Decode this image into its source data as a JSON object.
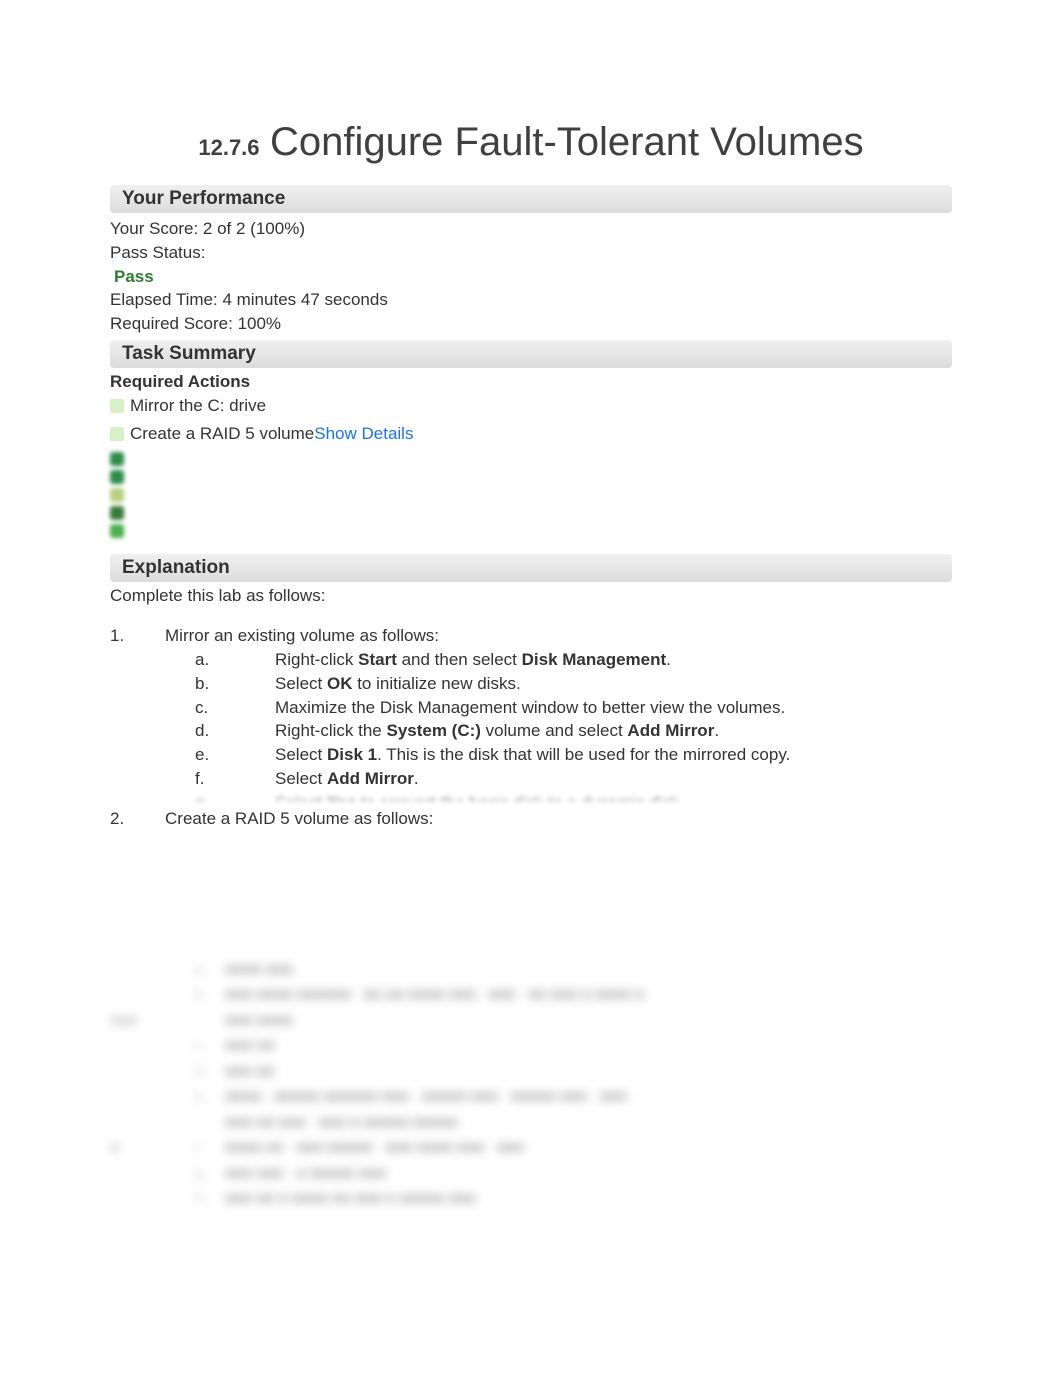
{
  "title": {
    "number": "12.7.6",
    "text": "Configure Fault-Tolerant Volumes"
  },
  "performance": {
    "header": "Your Performance",
    "score_line": "Your Score: 2 of 2 (100%)",
    "pass_label": "Pass Status:",
    "pass_value": "Pass",
    "elapsed": "Elapsed Time: 4 minutes 47 seconds",
    "required": "Required Score: 100%"
  },
  "task_summary": {
    "header": "Task Summary",
    "required_label": "Required Actions",
    "actions": [
      {
        "text": "Mirror the C: drive"
      },
      {
        "text": "Create a RAID 5 volume",
        "show_details": "Show Details"
      }
    ]
  },
  "explanation": {
    "header": "Explanation",
    "intro": "Complete this lab as follows:",
    "steps": [
      {
        "num": "1.",
        "text": "Mirror an existing volume as follows:",
        "sub": [
          {
            "m": "a.",
            "prefix": "Right-click ",
            "b1": "Start",
            "mid": " and then select ",
            "b2": "Disk Management",
            "suffix": "."
          },
          {
            "m": "b.",
            "prefix": "Select ",
            "b1": "OK",
            "mid": " to initialize new disks.",
            "b2": "",
            "suffix": ""
          },
          {
            "m": "c.",
            "prefix": "Maximize the Disk Management window to better view the volumes.",
            "b1": "",
            "mid": "",
            "b2": "",
            "suffix": ""
          },
          {
            "m": "d.",
            "prefix": "Right-click the ",
            "b1": "System (C:)",
            "mid": " volume and select ",
            "b2": "Add Mirror",
            "suffix": "."
          },
          {
            "m": "e.",
            "prefix": "Select ",
            "b1": "Disk 1",
            "mid": ". This is the disk that will be used for the mirrored copy.",
            "b2": "",
            "suffix": ""
          },
          {
            "m": "f.",
            "prefix": "Select ",
            "b1": "Add Mirror",
            "mid": ".",
            "b2": "",
            "suffix": ""
          }
        ]
      },
      {
        "num": "2.",
        "text": "Create a RAID 5 volume as follows:"
      }
    ]
  }
}
